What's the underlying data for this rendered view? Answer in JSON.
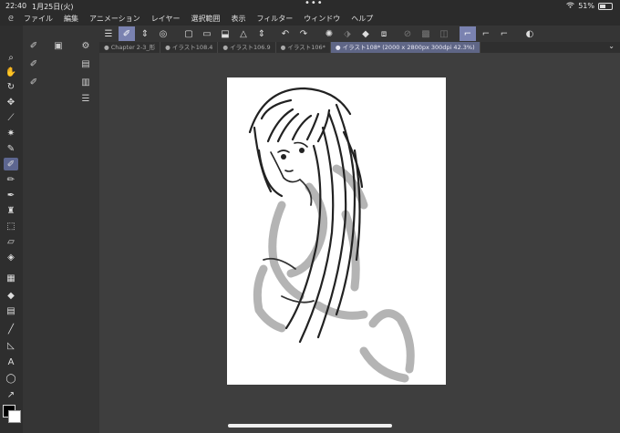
{
  "status": {
    "time": "22:40",
    "date": "1月25日(火)",
    "battery": "51%"
  },
  "menu": [
    "ファイル",
    "編集",
    "アニメーション",
    "レイヤー",
    "選択範囲",
    "表示",
    "フィルター",
    "ウィンドウ",
    "ヘルプ"
  ],
  "tabs": [
    {
      "label": "Chapter 2-3_形"
    },
    {
      "label": "イラスト108.4"
    },
    {
      "label": "イラスト106.9"
    },
    {
      "label": "イラスト106*"
    },
    {
      "label": "イラスト108* (2000 x 2800px 300dpi 42.3%)"
    }
  ],
  "colors": {
    "accent": "#7a82b0",
    "tab_active": "#5f6686",
    "canvas": "#ffffff",
    "background": "#3e3e3e"
  },
  "icons": {
    "tools": [
      "zoom-icon",
      "hand-icon",
      "rotate-icon",
      "move-icon",
      "eyedropper-icon",
      "magic-wand-icon",
      "pen-icon",
      "brush-icon",
      "pencil-icon",
      "airbrush-icon",
      "decoration-icon",
      "eraser-icon",
      "blend-icon",
      "fill-icon",
      "gradient-icon",
      "figure-icon",
      "ruler-icon",
      "text-icon",
      "lasso-icon",
      "select-icon"
    ]
  }
}
